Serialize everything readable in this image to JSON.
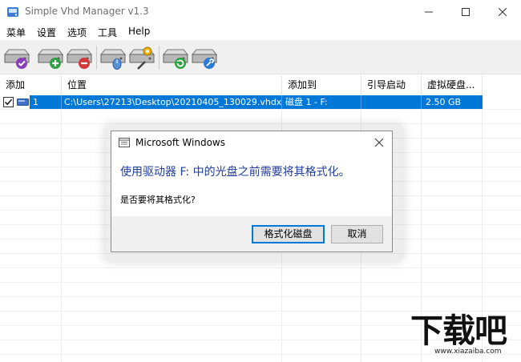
{
  "window": {
    "title": "Simple Vhd Manager v1.3",
    "controls": {
      "minimize": "minimize",
      "maximize": "maximize",
      "close": "close"
    }
  },
  "menu": [
    "菜单",
    "设置",
    "选项",
    "工具",
    "Help"
  ],
  "toolbar": {
    "buttons": [
      {
        "icon": "disk-check-icon"
      },
      {
        "icon": "disk-add-icon"
      },
      {
        "icon": "disk-remove-icon"
      },
      {
        "icon": "disk-mouse-icon"
      },
      {
        "icon": "disk-settings-icon"
      },
      {
        "icon": "disk-refresh-icon"
      },
      {
        "icon": "disk-tools-icon"
      }
    ]
  },
  "list": {
    "columns": [
      "添加",
      "位置",
      "添加到",
      "引导启动",
      "虚拟硬盘..."
    ],
    "rows": [
      {
        "checked": true,
        "index": "1",
        "location": "C:\\Users\\27213\\Desktop\\20210405_130029.vhdx",
        "attached_to": "磁盘 1 - F:",
        "boot": "",
        "size": "2.50 GB"
      }
    ]
  },
  "dialog": {
    "title": "Microsoft Windows",
    "main_instruction": "使用驱动器 F: 中的光盘之前需要将其格式化。",
    "content": "是否要将其格式化?",
    "buttons": {
      "primary": "格式化磁盘",
      "cancel": "取消"
    }
  },
  "watermark": {
    "logo_text": "下载吧",
    "url": "www.xiazaiba.com"
  },
  "colors": {
    "selection": "#0078d7",
    "instruction": "#1f3d9c",
    "toolbar_bg": "#f0f0f0",
    "accent_green": "#2ea043",
    "accent_red": "#d23a3a"
  }
}
